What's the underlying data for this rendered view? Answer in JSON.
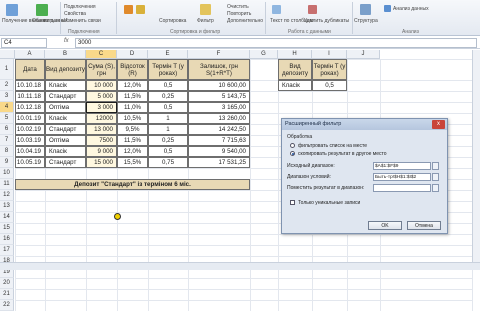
{
  "ribbon": {
    "get_external_data": "Получение внешних данных",
    "update_all": "Обновить все",
    "connections": "Подключения",
    "properties": "Свойства",
    "edit_links": "Изменить связи",
    "sort": "Сортировка",
    "filter": "Фильтр",
    "clear": "Очистить",
    "reapply": "Повторить",
    "advanced": "Дополнительно",
    "text_to_columns": "Текст по столбцам",
    "remove_duplicates": "Удалить дубликаты",
    "group_connections": "Подключения",
    "group_sort_filter": "Сортировка и фильтр",
    "group_data_tools": "Работа с данными",
    "structure": "Структура",
    "data_analysis": "Анализ данных",
    "group_analysis": "Анализ"
  },
  "formula_bar": {
    "name_box": "C4",
    "fx": "fx",
    "value": "3000"
  },
  "columns": [
    "A",
    "B",
    "C",
    "D",
    "E",
    "F",
    "G",
    "H",
    "I",
    "J"
  ],
  "rows": [
    "1",
    "2",
    "3",
    "4",
    "5",
    "6",
    "7",
    "8",
    "9",
    "10",
    "11",
    "12",
    "13",
    "14",
    "15",
    "16",
    "17",
    "18",
    "19",
    "20",
    "21",
    "22"
  ],
  "table": {
    "headers": [
      "Дата",
      "Вид депозиту",
      "Сума (S), грн",
      "Відсоток (R)",
      "Термін T (у роках)",
      "Залишок, грн S(1+R*T)"
    ],
    "rows": [
      [
        "10.10.18",
        "Класік",
        "10 000",
        "12,0%",
        "0,5",
        "10 600,00"
      ],
      [
        "10.11.18",
        "Стандарт",
        "5 000",
        "11,5%",
        "0,25",
        "5 143,75"
      ],
      [
        "10.12.18",
        "Оптіма",
        "3 000",
        "11,0%",
        "0,5",
        "3 165,00"
      ],
      [
        "10.01.19",
        "Класік",
        "12000",
        "10,5%",
        "1",
        "13 260,00"
      ],
      [
        "10.02.19",
        "Стандарт",
        "13 000",
        "9,5%",
        "1",
        "14 242,50"
      ],
      [
        "10.03.19",
        "Оптіма",
        "7500",
        "11,5%",
        "0,25",
        "7 715,63"
      ],
      [
        "10.04.19",
        "Класік",
        "9 000",
        "12,0%",
        "0,5",
        "9 540,00"
      ],
      [
        "10.05.19",
        "Стандарт",
        "15 000",
        "15,5%",
        "0,75",
        "17 531,25"
      ]
    ],
    "caption": "Депозит \"Стандарт\" із терміном 6 міс."
  },
  "criteria": {
    "headers": [
      "Вид депозиту",
      "Термін T (у роках)"
    ],
    "values": [
      "Класік",
      "0,5"
    ]
  },
  "dialog": {
    "title": "Расширенный фильтр",
    "close": "x",
    "section": "Обработка",
    "radio1": "фильтровать список на месте",
    "radio2": "скопировать результат в другое место",
    "list_range_label": "Исходный диапазон:",
    "list_range": "$A$1:$F$9",
    "criteria_range_label": "Диапазон условий:",
    "criteria_range": "Быть-тр!$H$1:$I$2",
    "copy_to_label": "Поместить результат в диапазон:",
    "copy_to": "",
    "unique_label": "Только уникальные записи",
    "ok": "OK",
    "cancel": "Отмена"
  }
}
